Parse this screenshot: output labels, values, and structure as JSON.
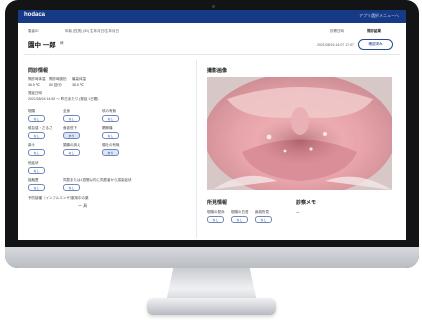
{
  "header": {
    "app_name": "hodaca",
    "header_link": "アプリ選択メニューへ"
  },
  "patient": {
    "id_label": "患者ID",
    "patient_info": "年齢 (性別) (ID) 生年月日/生年月日",
    "name": "園中 一郎",
    "name_suffix": "様",
    "record_label": "診察日時",
    "record_value": "2021/05/24 14:07 17:07",
    "status_label": "問診結果",
    "status_button": "確認済み"
  },
  "interview": {
    "title": "問診情報",
    "vitals_labels": [
      "問診時体温",
      "問診時脈拍",
      "最高体温"
    ],
    "vitals_values": [
      "36.5 ℃",
      "80 回/分",
      "38.5 ℃"
    ],
    "onset_label": "発症日時",
    "onset_value": "2021/05/24 14:52 ～ 昨日あたり (発症 1日間)",
    "symptom_fields": [
      {
        "label": "咽頭",
        "value": "なし"
      },
      {
        "label": "全身",
        "value": "なし"
      },
      {
        "label": "咳の有無",
        "value": "なし"
      },
      {
        "label": "倦怠感・だるさ",
        "value": "なし"
      },
      {
        "label": "食欲低下",
        "value": "あり"
      },
      {
        "label": "関節痛",
        "value": "なし"
      },
      {
        "label": "鼻汁",
        "value": "なし"
      },
      {
        "label": "頭痛の訴え",
        "value": "なし"
      },
      {
        "label": "嘔吐の有無",
        "value": "あり"
      }
    ],
    "other_label": "他症状",
    "other_value": "なし",
    "contact_label": "接触歴",
    "contact_value": "なし",
    "infection_label": "同居または1週間以内に同居者から感染症状",
    "infection_value": "なし",
    "vaccine_label": "予防接種（インフルエンザ）",
    "history_label": "服用中の薬",
    "history_value": "ー 具"
  },
  "image": {
    "title": "撮影画像"
  },
  "findings": {
    "title": "所見情報",
    "labels": [
      "咽頭の発赤",
      "咽頭の白苔",
      "扁桃所見"
    ],
    "values": [
      "なし",
      "なし",
      "なし"
    ],
    "memo_title": "診察メモ",
    "memo_value": "ー"
  }
}
